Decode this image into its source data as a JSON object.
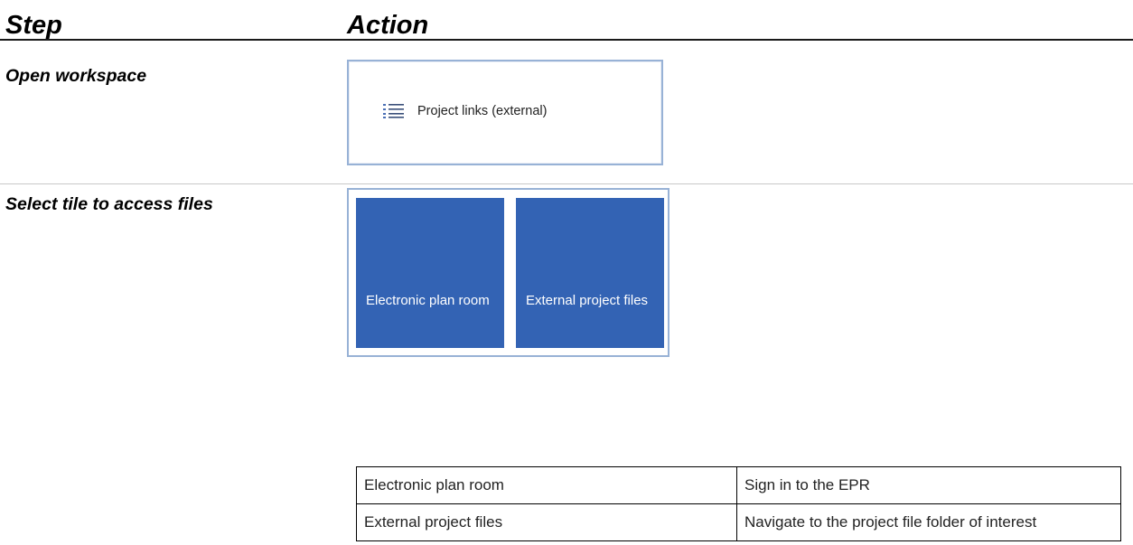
{
  "header": {
    "step": "Step",
    "action": "Action"
  },
  "steps": [
    {
      "label": "Open workspace",
      "screenshot": {
        "link_icon": "list-icon",
        "link_text": "Project links (external)"
      }
    },
    {
      "label": "Select tile to access files",
      "screenshot": {
        "tiles": [
          {
            "label": "Electronic plan room"
          },
          {
            "label": "External project files"
          }
        ],
        "tile_color": "#3363b4"
      }
    }
  ],
  "mapping_table": {
    "rows": [
      {
        "tile": "Electronic plan room",
        "action": "Sign in to the EPR"
      },
      {
        "tile": "External project files",
        "action": "Navigate to the project file folder of interest"
      }
    ]
  }
}
